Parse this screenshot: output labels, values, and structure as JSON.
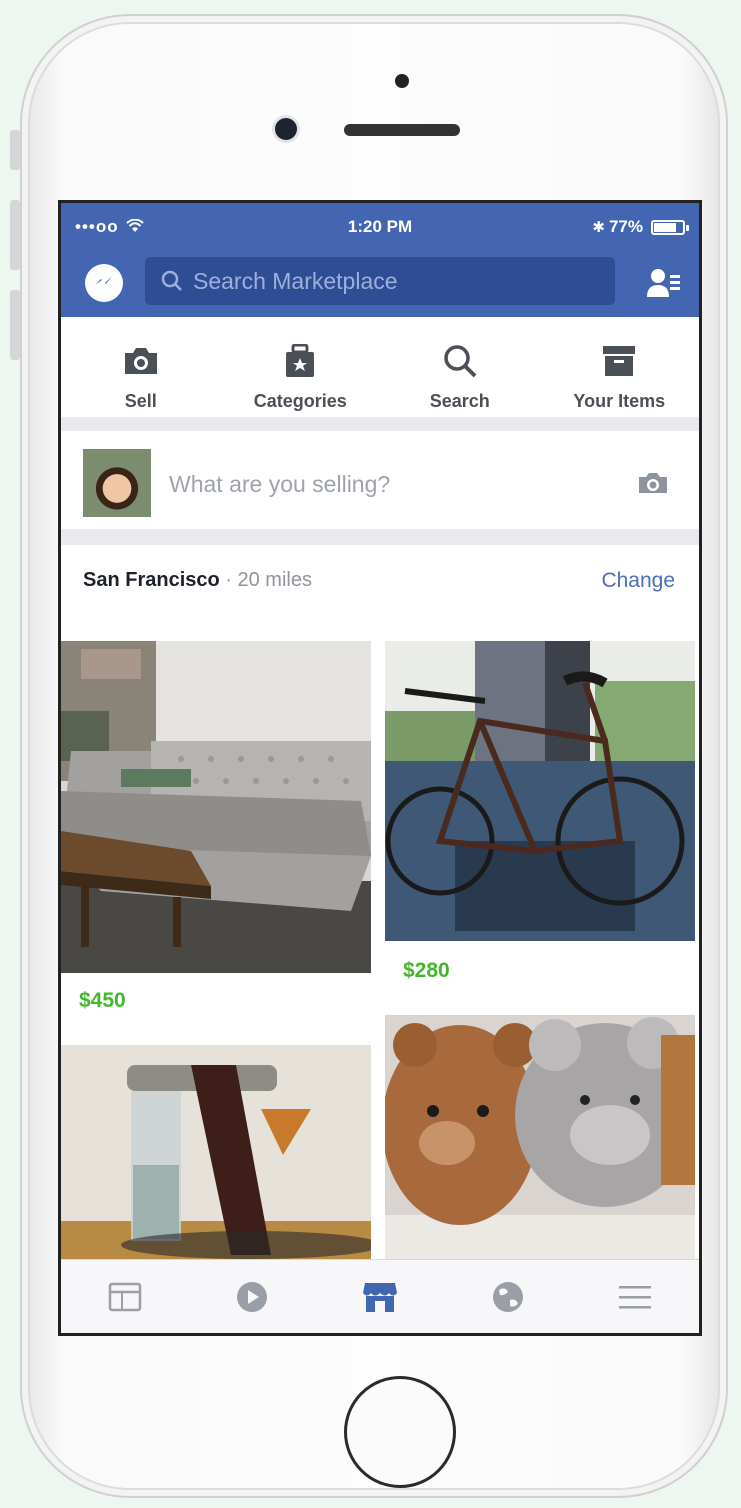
{
  "status_bar": {
    "signal": "•••oo",
    "time": "1:20 PM",
    "battery_text": "77%",
    "battery_level": 0.77
  },
  "header": {
    "search_placeholder": "Search Marketplace"
  },
  "actions": [
    {
      "label": "Sell",
      "icon": "camera-icon"
    },
    {
      "label": "Categories",
      "icon": "tag-bag-icon"
    },
    {
      "label": "Search",
      "icon": "search-icon"
    },
    {
      "label": "Your Items",
      "icon": "archive-box-icon"
    }
  ],
  "composer": {
    "placeholder": "What are you selling?"
  },
  "location": {
    "city": "San Francisco",
    "radius": " · 20 miles",
    "change_label": "Change"
  },
  "listings": [
    {
      "price": "$450",
      "image": "gray tufted sofa with coffee table"
    },
    {
      "price": "$280",
      "image": "fixed-gear bicycle"
    },
    {
      "price": "",
      "image": "pour-over coffee maker"
    },
    {
      "price": "",
      "image": "teddy bear plush toys"
    }
  ],
  "tabs": [
    {
      "name": "news-feed",
      "icon": "news-feed-icon",
      "active": false
    },
    {
      "name": "video",
      "icon": "play-icon",
      "active": false
    },
    {
      "name": "marketplace",
      "icon": "shop-icon",
      "active": true
    },
    {
      "name": "notifications",
      "icon": "globe-icon",
      "active": false
    },
    {
      "name": "menu",
      "icon": "hamburger-icon",
      "active": false
    }
  ],
  "colors": {
    "brand": "#4466b2",
    "price": "#42b72a",
    "link": "#4b6fb5"
  }
}
